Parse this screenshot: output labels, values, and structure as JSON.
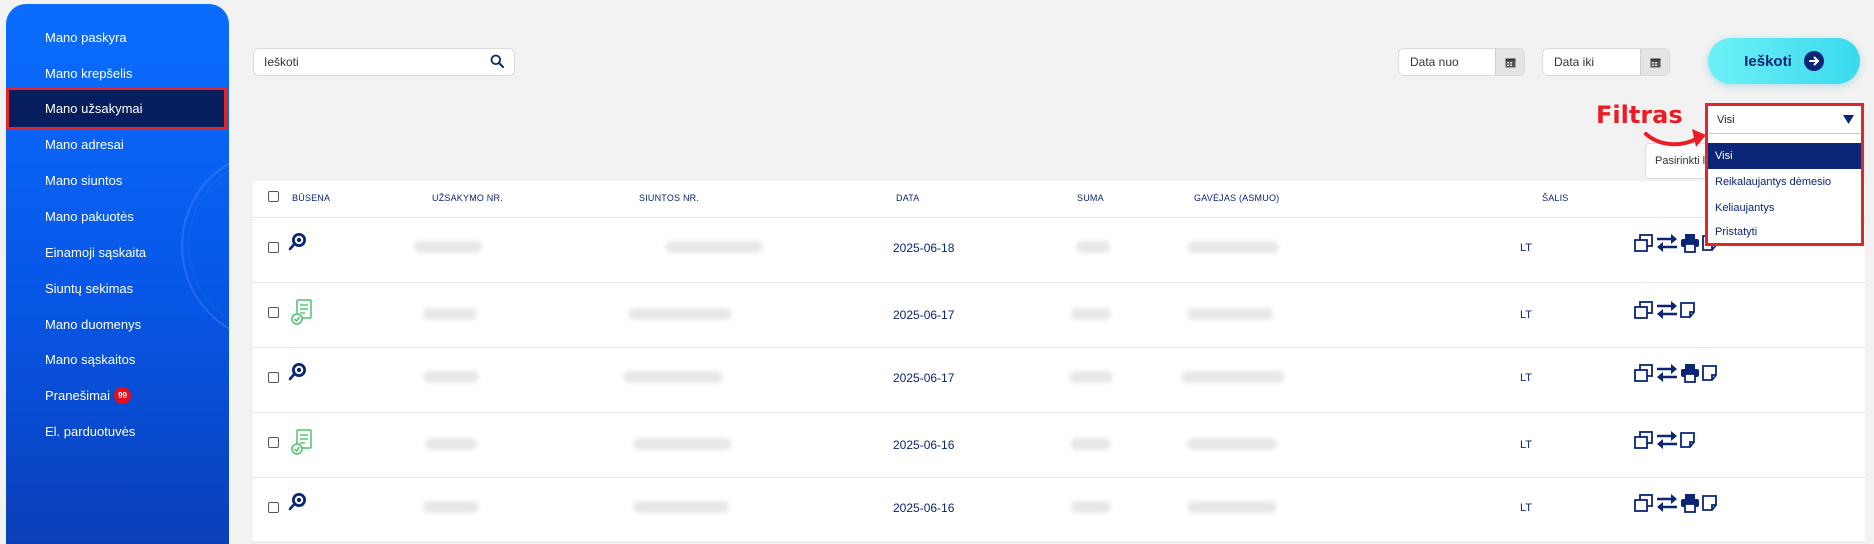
{
  "sidebar": {
    "items": [
      {
        "label": "Mano paskyra"
      },
      {
        "label": "Mano krepšelis"
      },
      {
        "label": "Mano užsakymai"
      },
      {
        "label": "Mano adresai"
      },
      {
        "label": "Mano siuntos"
      },
      {
        "label": "Mano pakuotės"
      },
      {
        "label": "Einamoji sąskaita"
      },
      {
        "label": "Siuntų sekimas"
      },
      {
        "label": "Mano duomenys"
      },
      {
        "label": "Mano sąskaitos"
      },
      {
        "label": "Pranešimai",
        "badge": "99"
      },
      {
        "label": "El. parduotuvės"
      }
    ],
    "active_item": "Mano užsakymai"
  },
  "toolbar": {
    "search_placeholder": "Ieškoti",
    "date_from": "Data nuo",
    "date_to": "Data iki",
    "search_button": "Ieškoti"
  },
  "annotation": {
    "label": "Filtras"
  },
  "bulk_action": {
    "label": "Pasirinkti l"
  },
  "status_filter": {
    "selected": "Visi",
    "options": [
      "Visi",
      "Reikalaujantys dėmesio",
      "Keliaujantys",
      "Pristatyti"
    ]
  },
  "table": {
    "headers": {
      "status": "BŪSENA",
      "order_no": "UŽSAKYMO NR.",
      "shipment_no": "SIUNTOS NR.",
      "date": "DATA",
      "amount": "SUMA",
      "recipient": "GAVĖJAS (ASMUO)",
      "country": "ŠALIS"
    },
    "rows": [
      {
        "status_icon": "search-tracking-icon",
        "date": "2025-06-18",
        "country": "LT",
        "printable": true
      },
      {
        "status_icon": "delivered-document-icon",
        "date": "2025-06-17",
        "country": "LT",
        "printable": false
      },
      {
        "status_icon": "search-tracking-icon",
        "date": "2025-06-17",
        "country": "LT",
        "printable": true
      },
      {
        "status_icon": "delivered-document-icon",
        "date": "2025-06-16",
        "country": "LT",
        "printable": false
      },
      {
        "status_icon": "search-tracking-icon",
        "date": "2025-06-16",
        "country": "LT",
        "printable": true
      }
    ]
  },
  "colors": {
    "sidebar_blue": "#0a6dff",
    "navy": "#0b2577",
    "highlight_red": "#e0262b",
    "cyan_button": "#39d9ee",
    "badge_red": "#e60f19",
    "delivered_green": "#4cc36b"
  }
}
